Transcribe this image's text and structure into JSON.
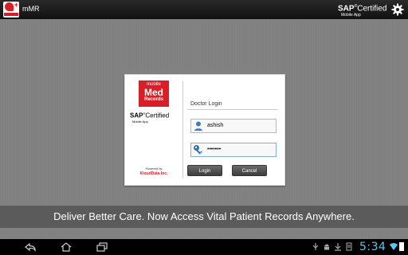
{
  "actionbar": {
    "app_title": "mMR",
    "sap_brand": "SAP",
    "sap_certified": "Certified",
    "sap_sub": "Mobile App",
    "settings_icon": "gear-icon"
  },
  "card": {
    "logo": {
      "line1": "mobile",
      "line2": "Med",
      "line3": "Records"
    },
    "sap_brand": "SAP",
    "sap_certified": "Certified",
    "sap_sub": "Mobile App",
    "powered_by": "Powered by",
    "company": "KloudData Inc.",
    "login_title": "Doctor Login",
    "username_value": "ashish",
    "password_value": "•••••••",
    "login_label": "Login",
    "cancel_label": "Cancel"
  },
  "tagline": "Deliver Better Care. Now Access Vital Patient Records Anywhere.",
  "sysbar": {
    "clock": "5:34",
    "accent": "#5ec4f0"
  },
  "colors": {
    "brand_red": "#d81e27"
  }
}
